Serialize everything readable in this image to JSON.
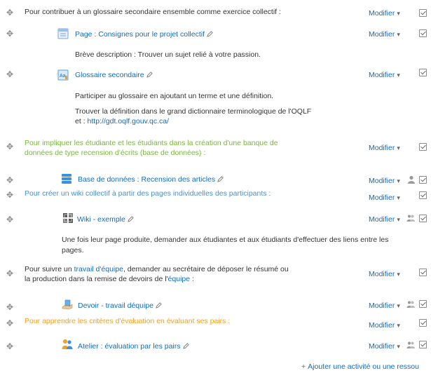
{
  "common": {
    "modifier": "Modifier",
    "caret": "▾"
  },
  "items": {
    "label1": "Pour contribuer à un glossaire secondaire ensemble comme exercice collectif :",
    "page": "Page : Consignes pour le projet collectif",
    "page_desc": "Brève description : Trouver un sujet relié à votre passion.",
    "glossaire": "Glossaire secondaire",
    "glossaire_desc1": "Participer au glossaire en ajoutant un terme et une définition.",
    "glossaire_desc2": "Trouver la définition dans le grand dictionnaire terminologique de l'OQLF",
    "glossaire_desc3_prefix": "et : ",
    "glossaire_url": "http://gdt.oqlf.gouv.qc.ca/",
    "label2_line1": "Pour impliquer les étudiante et les étudiants dans la création d'une banque de",
    "label2_line2": "données de type recension d'écrits (base de données) :",
    "bdd": "Base de données : Recension des articles",
    "label3": "Pour créer un wiki collectif à partir des pages individuelles des participants :",
    "wiki": "Wiki - exemple",
    "wiki_desc1": "Une fois leur page produite, demander aux étudiantes et aux étudiants d'effectuer des liens entre les",
    "wiki_desc2": "pages.",
    "label4_a": "Pour suivre un ",
    "label4_b": "travail d'équipe",
    "label4_c": ", demander au secrétaire de déposer le résumé ou",
    "label4_d": "la production dans la remise de devoirs de l'",
    "label4_e": "équipe",
    "label4_f": " :",
    "devoir": "Devoir - travail déquipe",
    "label5": "Pour apprendre les critères d'évaluation en évaluant ses pairs :",
    "atelier": "Atelier : évaluation par les pairs"
  },
  "footer": {
    "plus": "+",
    "label": "Ajouter une activité ou une ressou"
  },
  "colors": {
    "link": "#0f6cbf",
    "green_label": "#7ab53f",
    "blue_label": "#4a90c8",
    "orange_label": "#f0a025"
  },
  "icons": [
    "move-icon",
    "page-icon",
    "glossary-icon",
    "database-icon",
    "wiki-icon",
    "assignment-icon",
    "workshop-icon",
    "pencil-icon",
    "group-icon",
    "user-icon",
    "checkbox-icon"
  ]
}
